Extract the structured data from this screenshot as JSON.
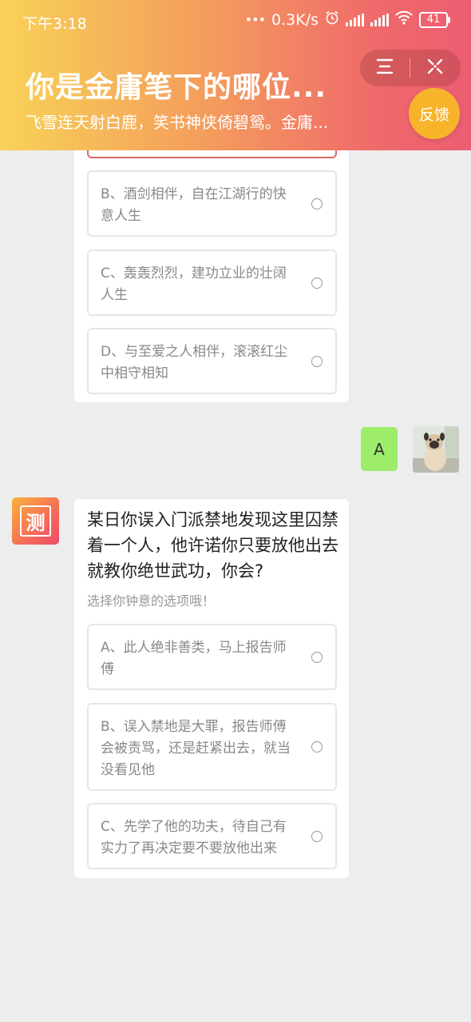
{
  "status": {
    "time": "下午3:18",
    "speed": "0.3K/s",
    "battery": "41"
  },
  "header": {
    "title": "你是金庸笔下的哪位...",
    "subtitle": "飞雪连天射白鹿，笑书神侠倚碧鸳。金庸...",
    "feedback_label": "反馈",
    "menu_icon": "menu-icon",
    "close_icon": "close-icon"
  },
  "prev_question": {
    "options": [
      {
        "text": "B、酒剑相伴，自在江湖行的快意人生"
      },
      {
        "text": "C、轰轰烈烈，建功立业的壮阔人生"
      },
      {
        "text": "D、与至爱之人相伴，滚滚红尘中相守相知"
      }
    ]
  },
  "user_reply": {
    "text": "A"
  },
  "bot": {
    "avatar_char": "测"
  },
  "current_question": {
    "question": "某日你误入门派禁地发现这里囚禁着一个人，他许诺你只要放他出去就教你绝世武功，你会?",
    "hint": "选择你钟意的选项哦！",
    "options": [
      {
        "text": "A、此人绝非善类，马上报告师傅"
      },
      {
        "text": "B、误入禁地是大罪，报告师傅会被责骂，还是赶紧出去，就当没看见他"
      },
      {
        "text": "C、先学了他的功夫，待自己有实力了再决定要不要放他出来"
      }
    ]
  },
  "colors": {
    "header_gradient_start": "#f8d257",
    "header_gradient_end": "#ec5d72",
    "user_bubble": "#9ded6b",
    "feedback_button": "#f7b42b"
  }
}
